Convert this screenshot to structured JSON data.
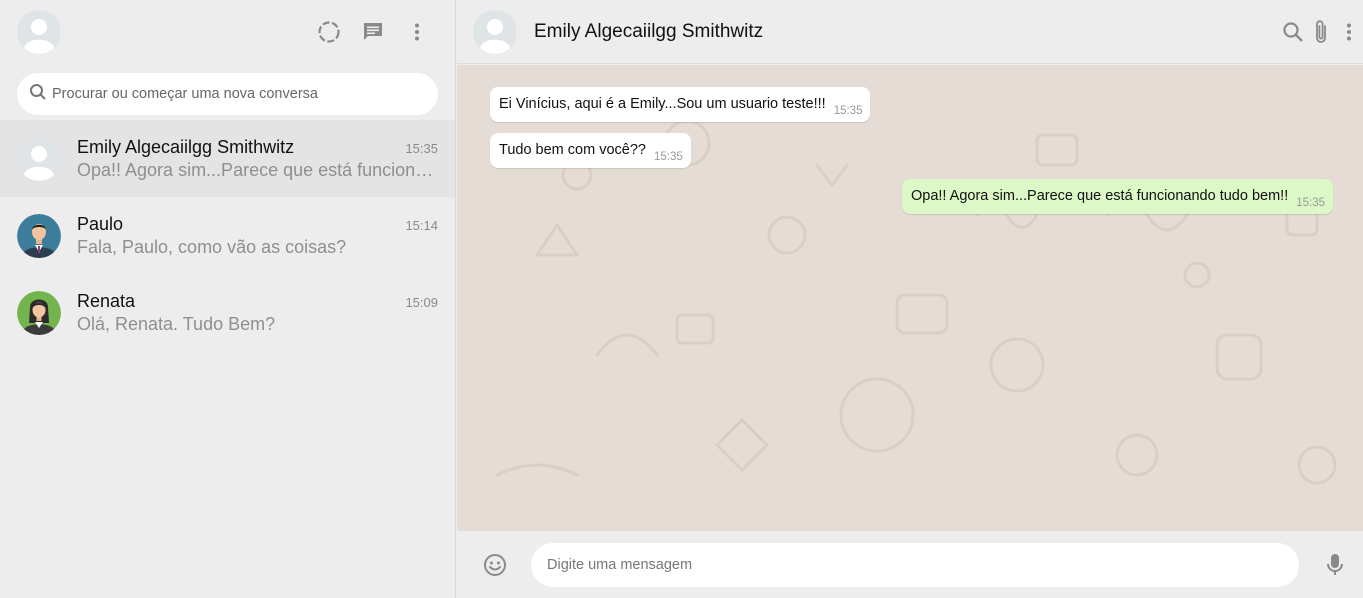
{
  "colors": {
    "chat_background": "#e5ddd5",
    "outgoing_bubble": "#dcf8c6",
    "incoming_bubble": "#ffffff",
    "panel": "#ededed",
    "icon": "#8a8a8a"
  },
  "sidebar": {
    "icons": [
      "status-icon",
      "new-chat-icon",
      "menu-icon"
    ],
    "search": {
      "placeholder": "Procurar ou começar uma nova conversa",
      "icon": "search-icon"
    },
    "chats": [
      {
        "name": "Emily Algecaiilgg Smithwitz",
        "time": "15:35",
        "last_message": "Opa!! Agora sim...Parece que está funcionando tudo bem!!",
        "avatar": "default-avatar",
        "active": true
      },
      {
        "name": "Paulo",
        "time": "15:14",
        "last_message": "Fala, Paulo, como vão as coisas?",
        "avatar": "man-avatar",
        "active": false
      },
      {
        "name": "Renata",
        "time": "15:09",
        "last_message": "Olá, Renata. Tudo Bem?",
        "avatar": "woman-avatar",
        "active": false
      }
    ]
  },
  "conversation": {
    "contact_name": "Emily Algecaiilgg Smithwitz",
    "header_icons": [
      "search-icon",
      "attach-icon",
      "menu-icon"
    ],
    "messages": [
      {
        "direction": "in",
        "text": "Ei Vinícius, aqui é a Emily...Sou um usuario teste!!!",
        "time": "15:35"
      },
      {
        "direction": "in",
        "text": "Tudo bem com você??",
        "time": "15:35"
      },
      {
        "direction": "out",
        "text": "Opa!! Agora sim...Parece que está funcionando tudo bem!!",
        "time": "15:35"
      }
    ]
  },
  "composer": {
    "placeholder": "Digite uma mensagem",
    "emoji_icon": "emoji-icon",
    "mic_icon": "mic-icon"
  }
}
